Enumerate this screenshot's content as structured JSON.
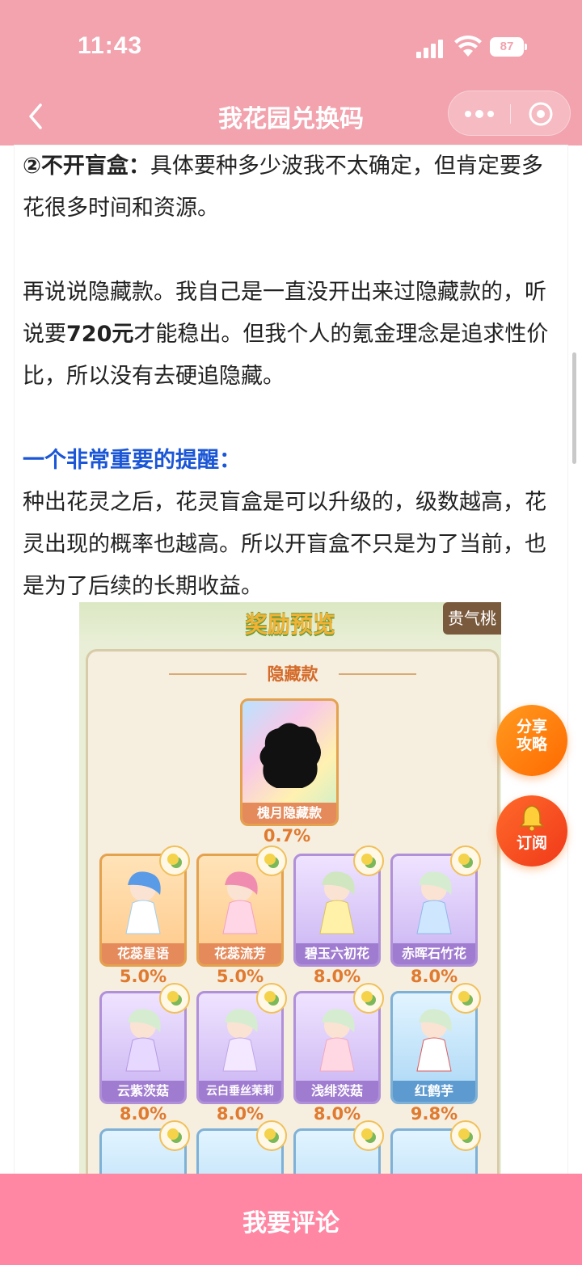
{
  "status_bar": {
    "time": "11:43",
    "battery": "87"
  },
  "nav": {
    "title": "我花园兑换码"
  },
  "article": {
    "p1_prefix": "②不开盲盒：",
    "p1_text": "具体要种多少波我不太确定，但肯定要多花很多时间和资源。",
    "p2_pre": "再说说隐藏款。我自己是一直没开出来过隐藏款的，听说要",
    "p2_bold": "720元",
    "p2_post": "才能稳出。但我个人的氪金理念是追求性价比，所以没有去硬追隐藏。",
    "heading": "一个非常重要的提醒：",
    "p3": "种出花灵之后，花灵盲盒是可以升级的，级数越高，花灵出现的概率也越高。所以开盲盒不只是为了当前，也是为了后续的长期收益。"
  },
  "game_image": {
    "title": "奖励预览",
    "side_tab": "贵气桃",
    "section": "隐藏款",
    "hidden": {
      "name": "槐月隐藏款",
      "rate": "0.7%"
    },
    "row1": [
      {
        "name": "花蕊星语",
        "rate": "5.0%"
      },
      {
        "name": "花蕊流芳",
        "rate": "5.0%"
      },
      {
        "name": "碧玉六初花",
        "rate": "8.0%"
      },
      {
        "name": "赤晖石竹花",
        "rate": "8.0%"
      }
    ],
    "row2": [
      {
        "name": "云紫茨菇",
        "rate": "8.0%"
      },
      {
        "name": "云白垂丝茉莉",
        "rate": "8.0%"
      },
      {
        "name": "浅绯茨菇",
        "rate": "8.0%"
      },
      {
        "name": "红鹤芋",
        "rate": "9.8%"
      }
    ]
  },
  "floating": {
    "share_line1": "分享",
    "share_line2": "攻略",
    "subscribe": "订阅"
  },
  "bottom": {
    "comment_label": "我要评论"
  },
  "colors": {
    "header": "#f2a3ae",
    "bottom_bar": "#ff87a3",
    "accent_blue": "#1a56d6",
    "float_orange": "#ff7a0f"
  }
}
